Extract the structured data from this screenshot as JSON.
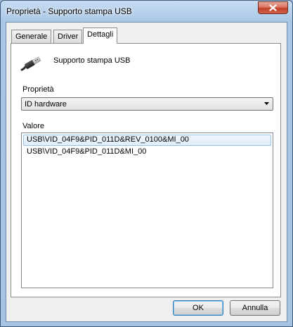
{
  "window": {
    "title": "Proprietà - Supporto stampa USB",
    "close_label": "close"
  },
  "tabs": [
    {
      "label": "Generale",
      "active": false
    },
    {
      "label": "Driver",
      "active": false
    },
    {
      "label": "Dettagli",
      "active": true
    }
  ],
  "device": {
    "icon": "usb-plug-icon",
    "name": "Supporto stampa USB"
  },
  "property": {
    "label": "Proprietà",
    "selected": "ID hardware"
  },
  "values": {
    "label": "Valore",
    "items": [
      {
        "text": "USB\\VID_04F9&PID_011D&REV_0100&MI_00",
        "selected": true
      },
      {
        "text": "USB\\VID_04F9&PID_011D&MI_00",
        "selected": false
      }
    ]
  },
  "buttons": {
    "ok": "OK",
    "cancel": "Annulla"
  },
  "colors": {
    "frame": "#a9c6e6",
    "close_button": "#c2412a",
    "selection_border": "#9ac4eb"
  }
}
